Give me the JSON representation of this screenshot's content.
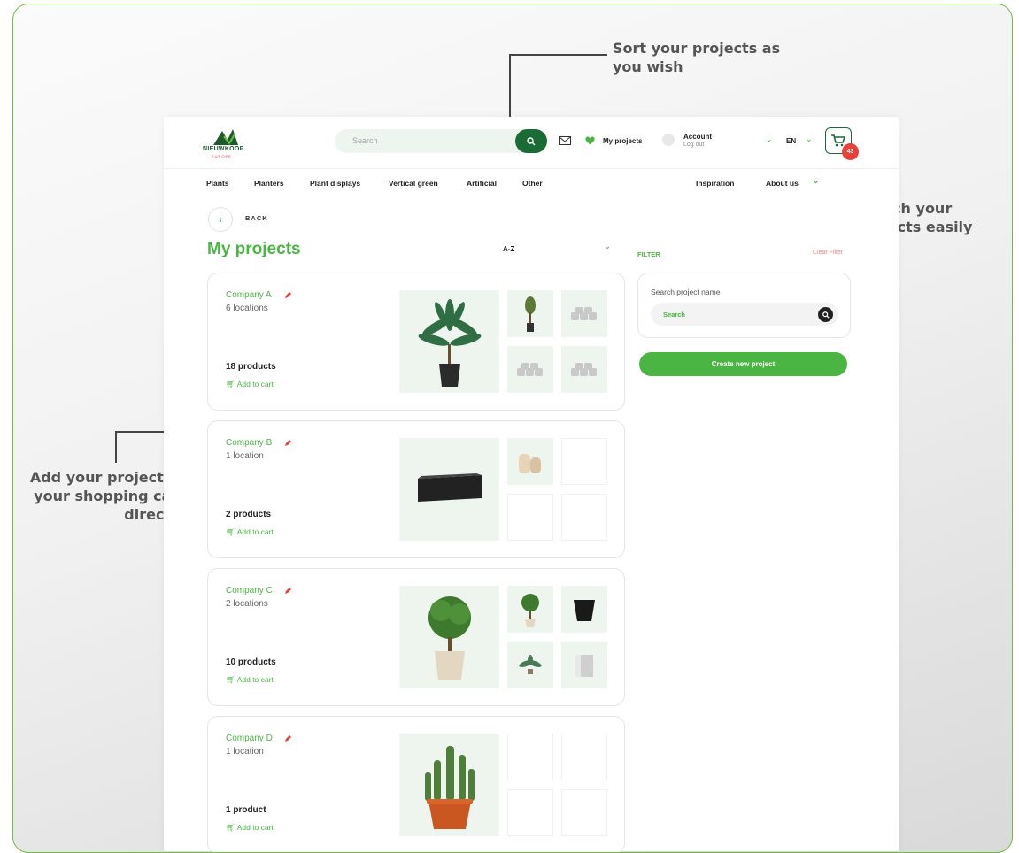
{
  "callouts": {
    "sort": "Sort your projects as you wish",
    "search": "Search your projects easily",
    "cart": "Add your project to your shopping cart directly"
  },
  "header": {
    "logo_text": "NIEUWKOOP",
    "logo_sub": "EUROPE",
    "search_placeholder": "Search",
    "my_projects": "My projects",
    "account": "Account",
    "logout": "Log out",
    "language": "EN",
    "cart_count": "43"
  },
  "nav": {
    "items": [
      "Plants",
      "Planters",
      "Plant displays",
      "Vertical green",
      "Artificial",
      "Other"
    ],
    "right_items": [
      "Inspiration",
      "About us"
    ]
  },
  "page": {
    "back": "BACK",
    "title": "My projects",
    "sort_value": "A-Z"
  },
  "projects": [
    {
      "name": "Company A",
      "locations": "6 locations",
      "products": "18 products",
      "add_to_cart": "Add to cart"
    },
    {
      "name": "Company B",
      "locations": "1 location",
      "products": "2 products",
      "add_to_cart": "Add to cart"
    },
    {
      "name": "Company C",
      "locations": "2 locations",
      "products": "10 products",
      "add_to_cart": "Add to cart"
    },
    {
      "name": "Company D",
      "locations": "1 location",
      "products": "1 product",
      "add_to_cart": "Add to cart"
    }
  ],
  "filter": {
    "label": "FILTER",
    "clear": "Clear Filter",
    "search_label": "Search project name",
    "search_placeholder": "Search",
    "create_button": "Create new project"
  },
  "colors": {
    "accent": "#4bb543",
    "dark_green": "#1b6b34",
    "cart_badge": "#e8413a",
    "tile_bg": "#eef5ee"
  }
}
